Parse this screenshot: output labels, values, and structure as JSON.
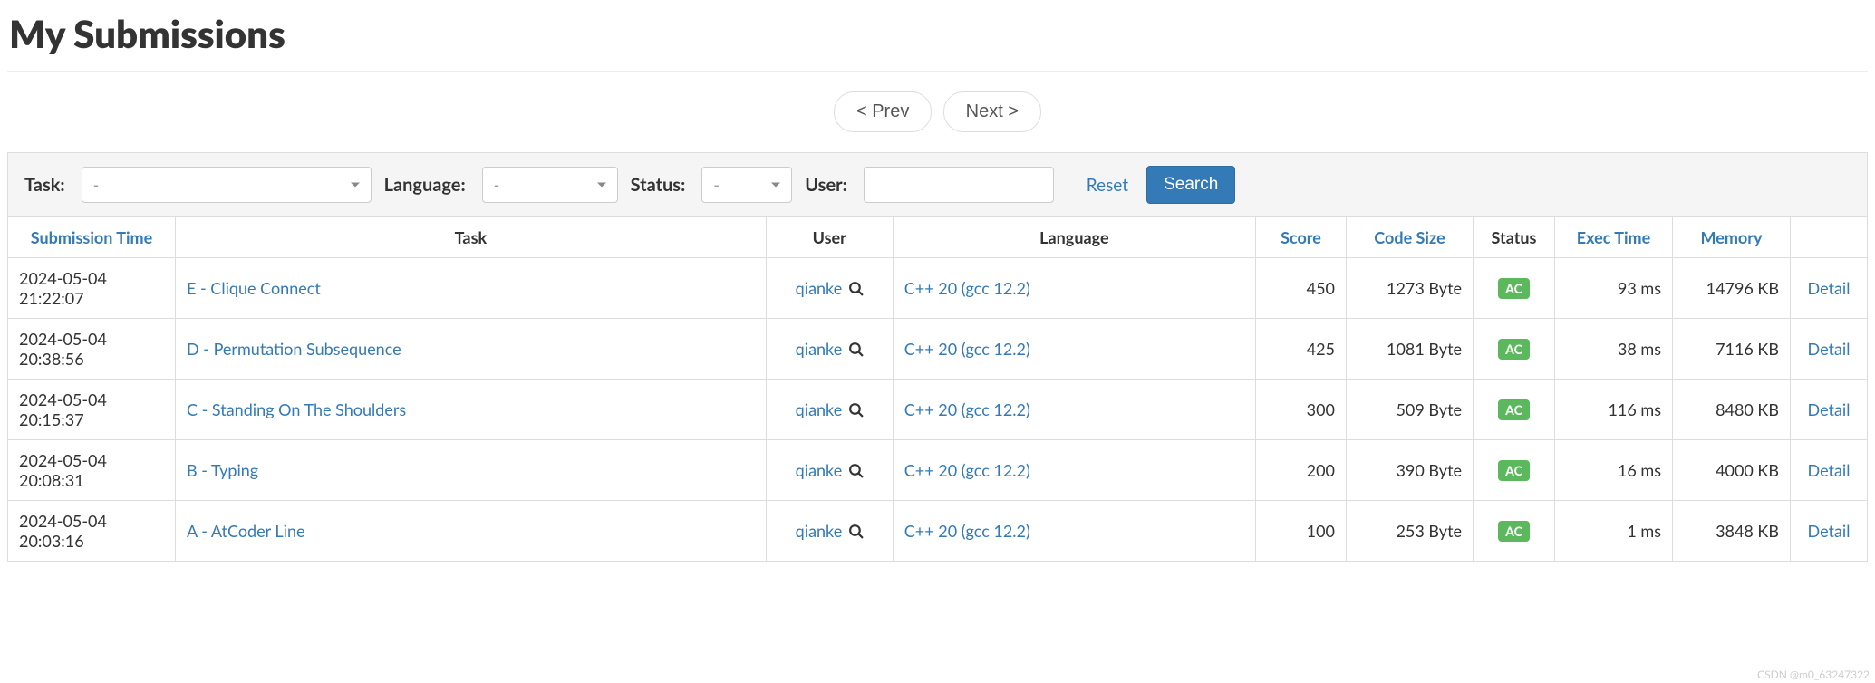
{
  "title": "My Submissions",
  "pager": {
    "prev": "< Prev",
    "next": "Next >"
  },
  "filters": {
    "task": {
      "label": "Task:",
      "value": "-"
    },
    "language": {
      "label": "Language:",
      "value": "-"
    },
    "status": {
      "label": "Status:",
      "value": "-"
    },
    "user": {
      "label": "User:",
      "value": ""
    },
    "reset": "Reset",
    "search": "Search"
  },
  "columns": {
    "time": "Submission Time",
    "task": "Task",
    "user": "User",
    "lang": "Language",
    "score": "Score",
    "size": "Code Size",
    "status": "Status",
    "exec": "Exec Time",
    "mem": "Memory",
    "detail": "Detail"
  },
  "status_colors": {
    "AC": "#5cb85c"
  },
  "rows": [
    {
      "time": "2024-05-04 21:22:07",
      "task": "E - Clique Connect",
      "user": "qianke",
      "lang": "C++ 20 (gcc 12.2)",
      "score": "450",
      "size": "1273 Byte",
      "status": "AC",
      "exec": "93 ms",
      "mem": "14796 KB"
    },
    {
      "time": "2024-05-04 20:38:56",
      "task": "D - Permutation Subsequence",
      "user": "qianke",
      "lang": "C++ 20 (gcc 12.2)",
      "score": "425",
      "size": "1081 Byte",
      "status": "AC",
      "exec": "38 ms",
      "mem": "7116 KB"
    },
    {
      "time": "2024-05-04 20:15:37",
      "task": "C - Standing On The Shoulders",
      "user": "qianke",
      "lang": "C++ 20 (gcc 12.2)",
      "score": "300",
      "size": "509 Byte",
      "status": "AC",
      "exec": "116 ms",
      "mem": "8480 KB"
    },
    {
      "time": "2024-05-04 20:08:31",
      "task": "B - Typing",
      "user": "qianke",
      "lang": "C++ 20 (gcc 12.2)",
      "score": "200",
      "size": "390 Byte",
      "status": "AC",
      "exec": "16 ms",
      "mem": "4000 KB"
    },
    {
      "time": "2024-05-04 20:03:16",
      "task": "A - AtCoder Line",
      "user": "qianke",
      "lang": "C++ 20 (gcc 12.2)",
      "score": "100",
      "size": "253 Byte",
      "status": "AC",
      "exec": "1 ms",
      "mem": "3848 KB"
    }
  ],
  "watermark": "CSDN @m0_63247322"
}
